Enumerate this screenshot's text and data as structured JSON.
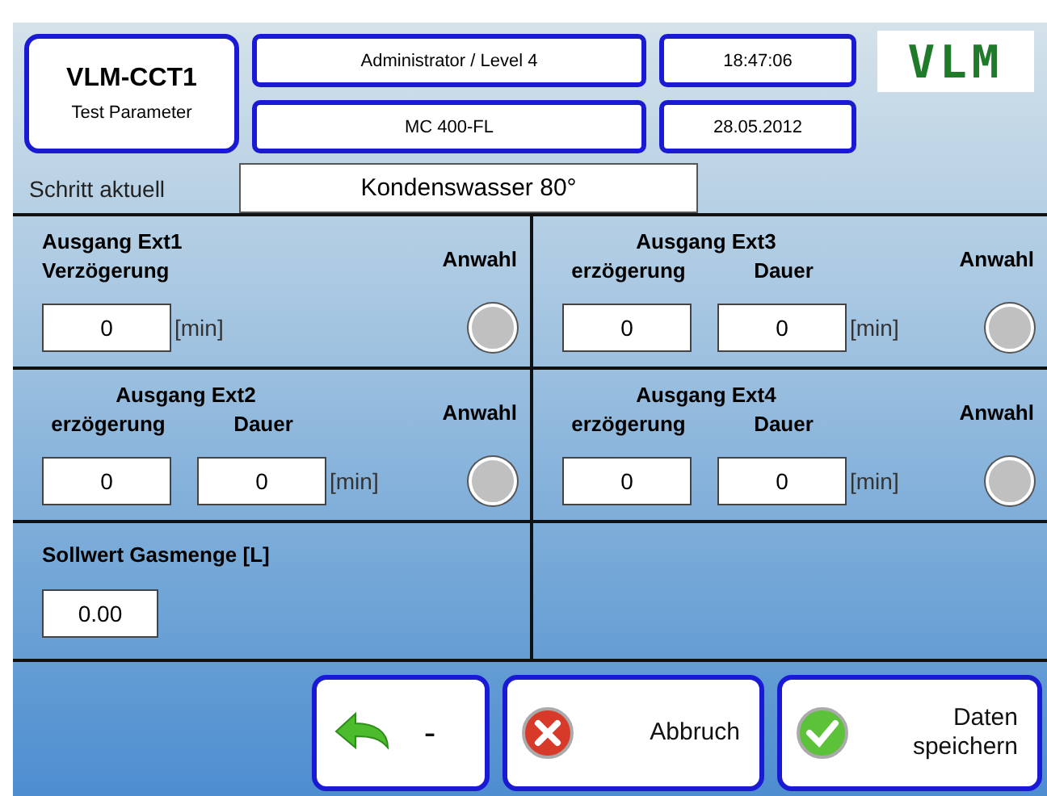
{
  "header": {
    "title": "VLM-CCT1",
    "subtitle": "Test Parameter",
    "user": "Administrator / Level 4",
    "time": "18:47:06",
    "device": "MC 400-FL",
    "date": "28.05.2012",
    "logo": "VLM"
  },
  "step": {
    "label": "Schritt aktuell",
    "value": "Kondenswasser 80°"
  },
  "outputs": [
    {
      "title": "Ausgang Ext1",
      "fields": [
        {
          "label": "Verzögerung",
          "value": "0"
        }
      ],
      "unit": "[min]",
      "select_label": "Anwahl",
      "selected": false
    },
    {
      "title": "Ausgang Ext3",
      "fields": [
        {
          "label": "erzögerung",
          "value": "0"
        },
        {
          "label": "Dauer",
          "value": "0"
        }
      ],
      "unit": "[min]",
      "select_label": "Anwahl",
      "selected": false
    },
    {
      "title": "Ausgang Ext2",
      "fields": [
        {
          "label": "erzögerung",
          "value": "0"
        },
        {
          "label": "Dauer",
          "value": "0"
        }
      ],
      "unit": "[min]",
      "select_label": "Anwahl",
      "selected": false
    },
    {
      "title": "Ausgang Ext4",
      "fields": [
        {
          "label": "erzögerung",
          "value": "0"
        },
        {
          "label": "Dauer",
          "value": "0"
        }
      ],
      "unit": "[min]",
      "select_label": "Anwahl",
      "selected": false
    }
  ],
  "setpoint": {
    "label": "Sollwert Gasmenge [L]",
    "value": "0.00"
  },
  "buttons": [
    {
      "kind": "back",
      "label": "-"
    },
    {
      "kind": "cancel",
      "label": "Abbruch"
    },
    {
      "kind": "save",
      "label": "Daten speichern"
    }
  ]
}
